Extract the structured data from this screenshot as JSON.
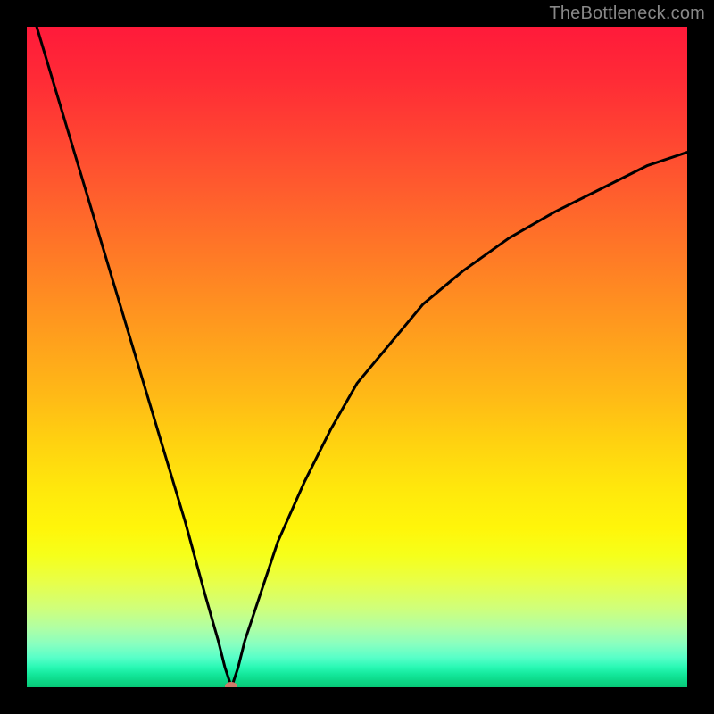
{
  "watermark": "TheBottleneck.com",
  "chart_data": {
    "type": "line",
    "title": "",
    "xlabel": "",
    "ylabel": "",
    "x_range": [
      0,
      100
    ],
    "y_range": [
      0,
      100
    ],
    "background_gradient": {
      "top_color": "#ff1a3a",
      "mid_color": "#ffd210",
      "bottom_color": "#08c878"
    },
    "marker": {
      "x": 31,
      "y": 0,
      "color": "#cf7a6a"
    },
    "series": [
      {
        "name": "bottleneck-curve",
        "x": [
          0,
          3,
          6,
          9,
          12,
          15,
          18,
          21,
          24,
          27,
          29,
          30,
          31,
          32,
          33,
          35,
          38,
          42,
          46,
          50,
          55,
          60,
          66,
          73,
          80,
          88,
          94,
          100
        ],
        "y": [
          105,
          95,
          85,
          75,
          65,
          55,
          45,
          35,
          25,
          14,
          7,
          3,
          0,
          3,
          7,
          13,
          22,
          31,
          39,
          46,
          52,
          58,
          63,
          68,
          72,
          76,
          79,
          81
        ]
      }
    ],
    "annotations": []
  }
}
